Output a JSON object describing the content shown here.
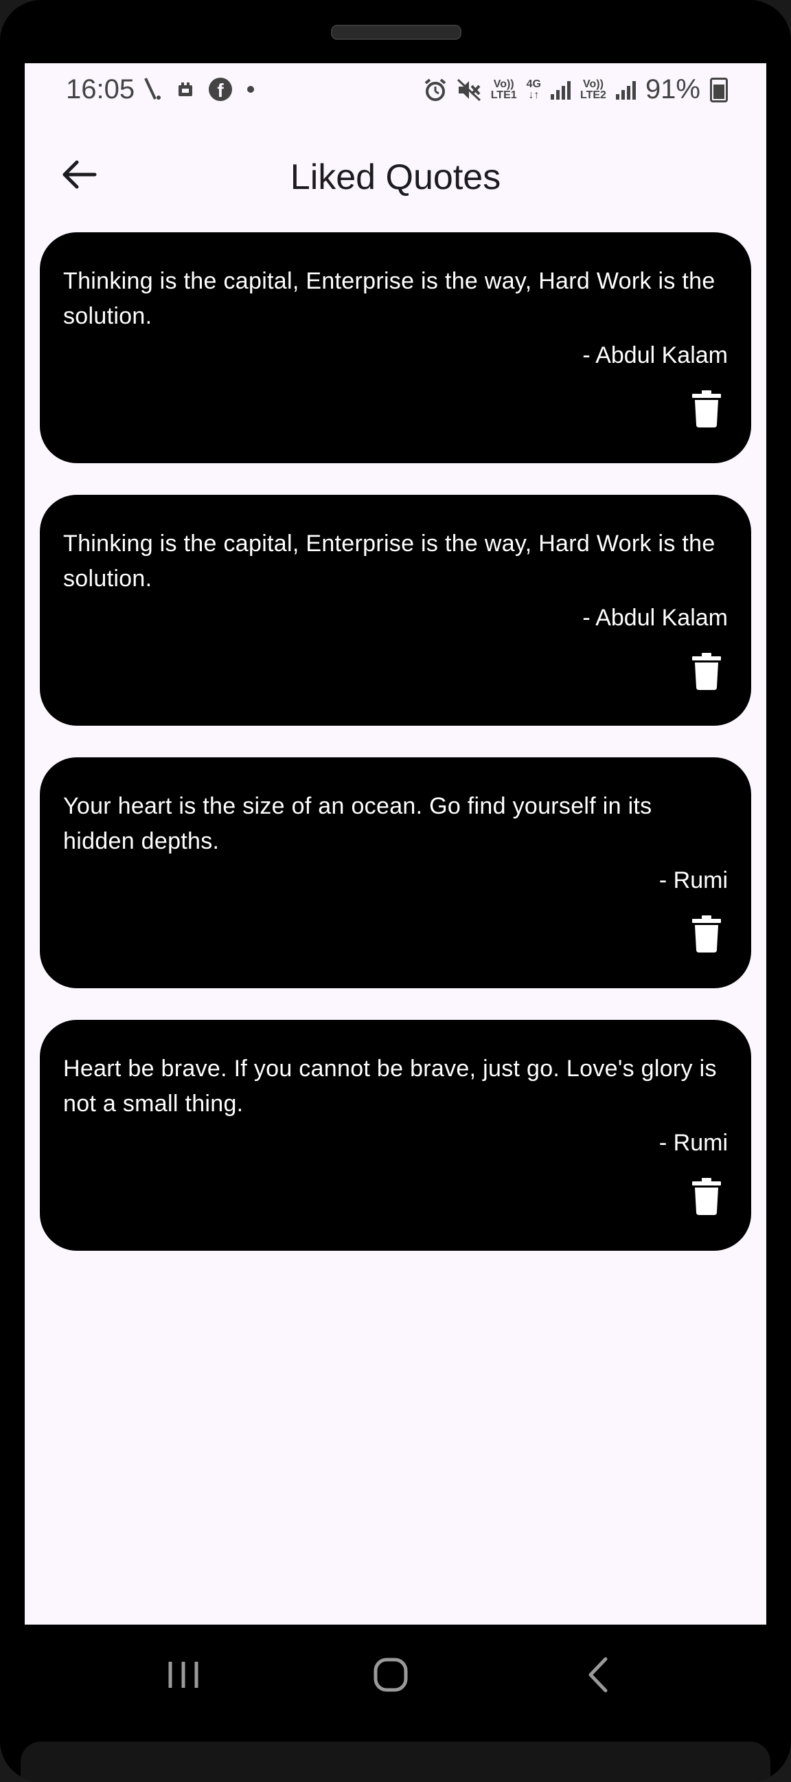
{
  "status_bar": {
    "time": "16:05",
    "net1_top": "Vo))",
    "net1_bottom": "LTE1",
    "net_4g": "4G",
    "net2_top": "Vo))",
    "net2_bottom": "LTE2",
    "battery_percent": "91%",
    "icons": [
      "signal-slash-icon",
      "media-icon",
      "facebook-icon",
      "dot-icon",
      "alarm-icon",
      "mute-icon",
      "signal-bars-icon",
      "battery-icon"
    ]
  },
  "app_bar": {
    "title": "Liked Quotes",
    "back_icon": "arrow-left-icon"
  },
  "quotes": [
    {
      "text": "Thinking is the capital, Enterprise is the way, Hard Work is the solution.",
      "author": "- Abdul Kalam"
    },
    {
      "text": "Thinking is the capital, Enterprise is the way, Hard Work is the solution.",
      "author": "- Abdul Kalam"
    },
    {
      "text": "Your heart is the size of an ocean. Go find yourself in its hidden depths.",
      "author": "- Rumi"
    },
    {
      "text": "Heart be brave. If you cannot be brave, just go. Love's glory is not a small thing.",
      "author": "- Rumi"
    }
  ],
  "nav_bar": {
    "icons": [
      "recents-icon",
      "home-icon",
      "back-icon"
    ]
  },
  "colors": {
    "screen_bg": "#fcf7ff",
    "card_bg": "#000000",
    "card_text": "#ffffff",
    "title_text": "#1c1b1f"
  }
}
